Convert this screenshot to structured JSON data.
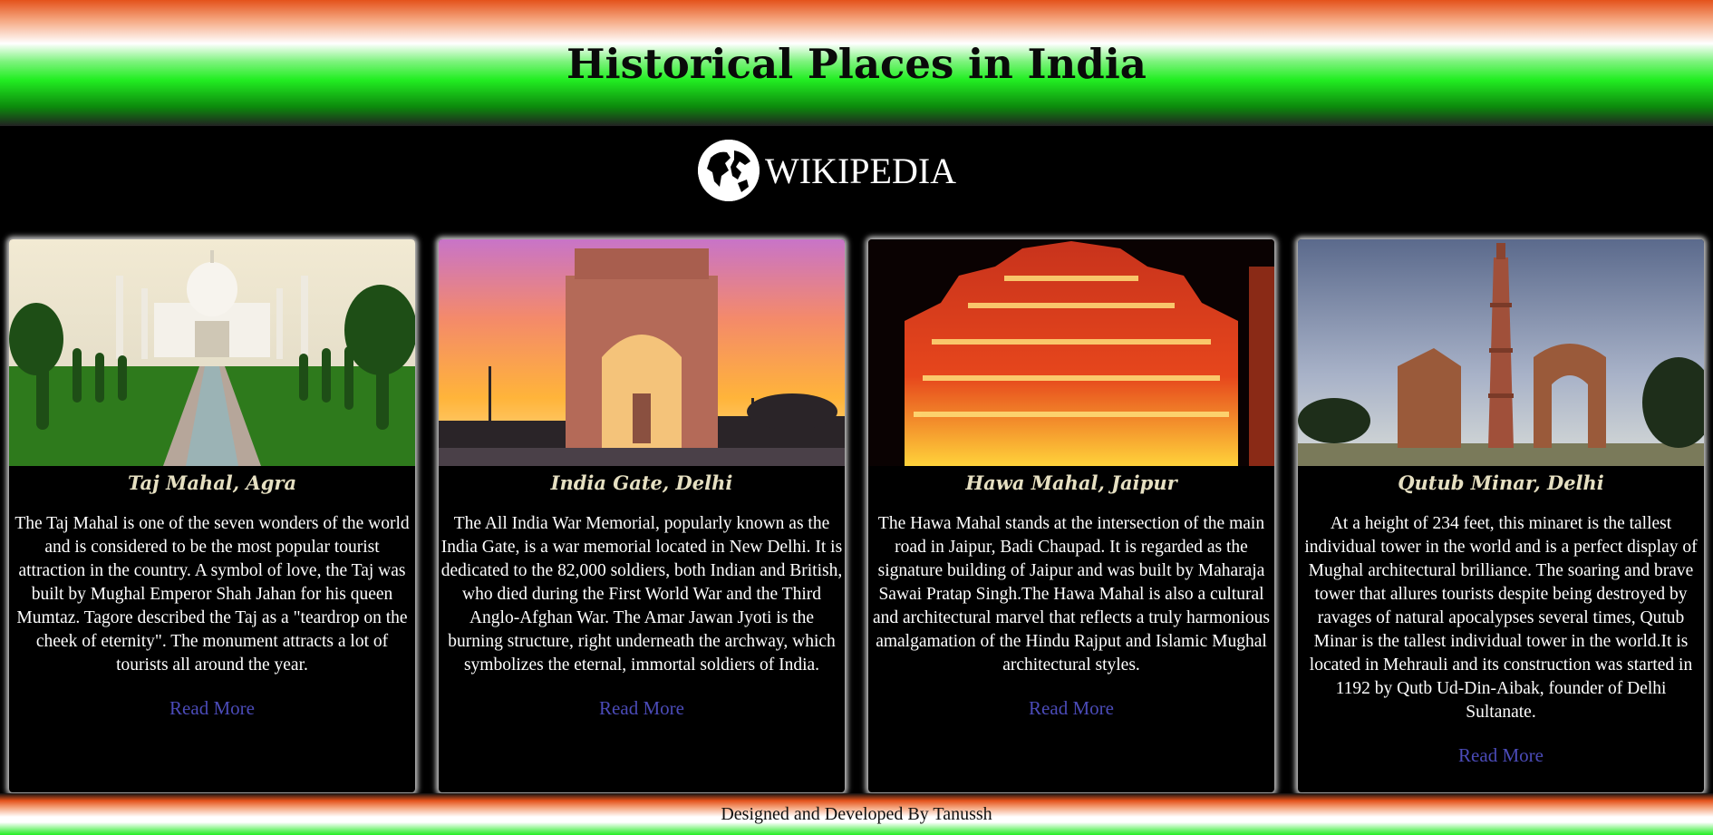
{
  "header": {
    "title": "Historical Places in India"
  },
  "brand": {
    "text": "WIKIPEDIA",
    "icon": "globe-icon"
  },
  "cards": [
    {
      "title": "Taj Mahal, Agra",
      "description": "The Taj Mahal is one of the seven wonders of the world and is considered to be the most popular tourist attraction in the country. A symbol of love, the Taj was built by Mughal Emperor Shah Jahan for his queen Mumtaz. Tagore described the Taj as a \"teardrop on the cheek of eternity\". The monument attracts a lot of tourists all around the year.",
      "link": "Read More"
    },
    {
      "title": "India Gate, Delhi",
      "description": "The All India War Memorial, popularly known as the India Gate, is a war memorial located in New Delhi. It is dedicated to the 82,000 soldiers, both Indian and British, who died during the First World War and the Third Anglo-Afghan War. The Amar Jawan Jyoti is the burning structure, right underneath the archway, which symbolizes the eternal, immortal soldiers of India.",
      "link": "Read More"
    },
    {
      "title": "Hawa Mahal, Jaipur",
      "description": "The Hawa Mahal stands at the intersection of the main road in Jaipur, Badi Chaupad. It is regarded as the signature building of Jaipur and was built by Maharaja Sawai Pratap Singh.The Hawa Mahal is also a cultural and architectural marvel that reflects a truly harmonious amalgamation of the Hindu Rajput and Islamic Mughal architectural styles.",
      "link": "Read More"
    },
    {
      "title": "Qutub Minar, Delhi",
      "description": "At a height of 234 feet, this minaret is the tallest individual tower in the world and is a perfect display of Mughal architectural brilliance. The soaring and brave tower that allures tourists despite being destroyed by ravages of natural apocalypses several times, Qutub Minar is the tallest individual tower in the world.It is located in Mehrauli and its construction was started in 1192 by Qutb Ud-Din-Aibak, founder of Delhi Sultanate.",
      "link": "Read More"
    }
  ],
  "footer": {
    "text": "Designed and Developed By Tanussh"
  },
  "colors": {
    "saffron": "#e4521b",
    "green": "#22ee22",
    "card_title": "#e6e0c2",
    "link": "#4b4bb8"
  }
}
